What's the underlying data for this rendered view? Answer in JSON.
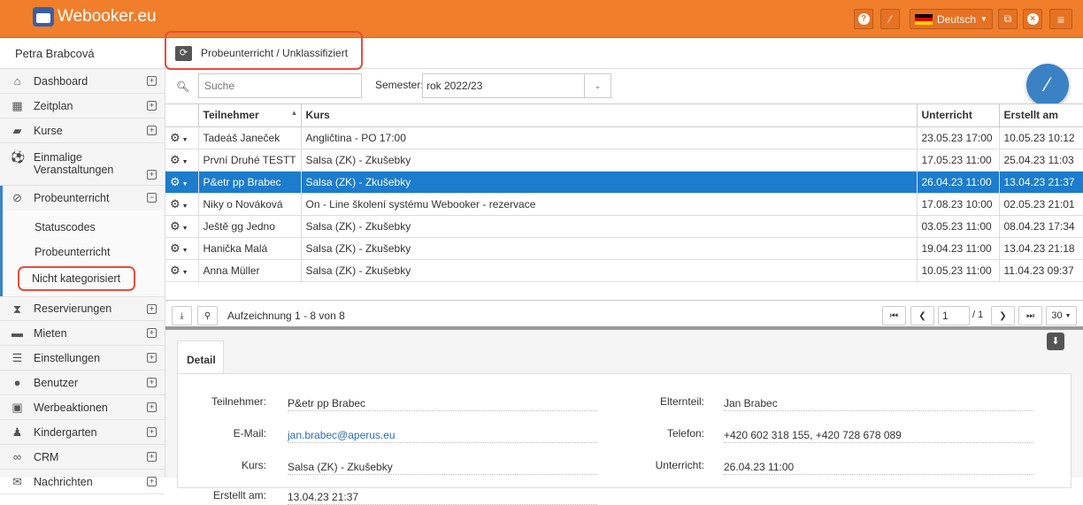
{
  "app": {
    "logo": "Webooker.eu",
    "language": "Deutsch"
  },
  "sidebar": {
    "user": "Petra Brabcová",
    "items": [
      {
        "label": "Dashboard",
        "icon": "home-icon"
      },
      {
        "label": "Zeitplan",
        "icon": "calendar-icon"
      },
      {
        "label": "Kurse",
        "icon": "book-icon"
      },
      {
        "label": "Einmalige Veranstaltungen",
        "icon": "ball-icon"
      },
      {
        "label": "Probeunterricht",
        "icon": "eye-slash-icon"
      },
      {
        "label": "Reservierungen",
        "icon": "hourglass-icon"
      },
      {
        "label": "Mieten",
        "icon": "bed-icon"
      },
      {
        "label": "Einstellungen",
        "icon": "sliders-icon"
      },
      {
        "label": "Benutzer",
        "icon": "users-icon"
      },
      {
        "label": "Werbeaktionen",
        "icon": "gift-icon"
      },
      {
        "label": "Kindergarten",
        "icon": "child-icon"
      },
      {
        "label": "CRM",
        "icon": "handshake-icon"
      },
      {
        "label": "Nachrichten",
        "icon": "envelope-icon"
      }
    ],
    "subitems": [
      "Statuscodes",
      "Probeunterricht",
      "Nicht kategorisiert"
    ]
  },
  "breadcrumb": "Probeunterricht / Unklassifiziert",
  "search": {
    "placeholder": "Suche",
    "semester_label": "Semester:",
    "semester_value": "rok 2022/23"
  },
  "table": {
    "headers": [
      "Teilnehmer",
      "Kurs",
      "Unterricht",
      "Erstellt am"
    ],
    "rows": [
      [
        "Tadeáš Janeček",
        "Angličtina - PO 17:00",
        "23.05.23 17:00",
        "10.05.23 10:12"
      ],
      [
        "První Druhé TESTT",
        "Salsa (ZK) - Zkušebky",
        "17.05.23 11:00",
        "25.04.23 11:03"
      ],
      [
        "P&etr pp Brabec",
        "Salsa (ZK) - Zkušebky",
        "26.04.23 11:00",
        "13.04.23 21:37"
      ],
      [
        "Niky o Nováková",
        "On - Line školení systému Webooker - rezervace",
        "17.08.23 10:00",
        "02.05.23 21:01"
      ],
      [
        "Ještě gg Jedno",
        "Salsa (ZK) - Zkušebky",
        "03.05.23 11:00",
        "08.04.23 17:34"
      ],
      [
        "Hanička Malá",
        "Salsa (ZK) - Zkušebky",
        "19.04.23 11:00",
        "13.04.23 21:18"
      ],
      [
        "Anna Müller",
        "Salsa (ZK) - Zkušebky",
        "10.05.23 11:00",
        "11.04.23 09:37"
      ]
    ]
  },
  "pager": {
    "records": "Aufzeichnung 1 - 8 von 8",
    "page": "1",
    "of": "/ 1",
    "size": "30"
  },
  "detail": {
    "tab": "Detail",
    "teilnehmer_label": "Teilnehmer:",
    "teilnehmer": "P&etr pp Brabec",
    "email_label": "E-Mail:",
    "email": "jan.brabec@aperus.eu",
    "kurs_label": "Kurs:",
    "kurs": "Salsa (ZK) - Zkušebky",
    "erstellt_label": "Erstellt am:",
    "erstellt": "13.04.23 21:37",
    "elternteil_label": "Elternteil:",
    "elternteil": "Jan Brabec",
    "telefon_label": "Telefon:",
    "telefon": "+420 602 318 155, +420 728 678 089",
    "unterricht_label": "Unterricht:",
    "unterricht": "26.04.23 11:00"
  }
}
